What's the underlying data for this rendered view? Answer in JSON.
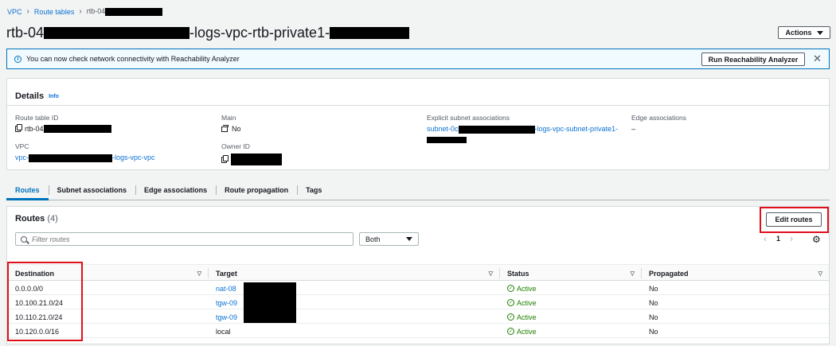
{
  "breadcrumb": {
    "root": "VPC",
    "section": "Route tables",
    "current_prefix": "rtb-04"
  },
  "header": {
    "title_prefix": "rtb-04",
    "title_middle": "-logs-vpc-rtb-private1-",
    "actions_label": "Actions"
  },
  "banner": {
    "message": "You can now check network connectivity with Reachability Analyzer",
    "button_label": "Run Reachability Analyzer"
  },
  "details": {
    "heading": "Details",
    "info_label": "Info",
    "route_table_id": {
      "label": "Route table ID",
      "value_prefix": "rtb-04"
    },
    "main": {
      "label": "Main",
      "value": "No"
    },
    "explicit_subnet": {
      "label": "Explicit subnet associations",
      "value_prefix": "subnet-0c",
      "value_suffix": "-logs-vpc-subnet-private1-"
    },
    "edge": {
      "label": "Edge associations",
      "value": "–"
    },
    "vpc": {
      "label": "VPC",
      "value_prefix": "vpc-",
      "value_suffix": "-logs-vpc-vpc"
    },
    "owner_id": {
      "label": "Owner ID"
    }
  },
  "tabs": [
    "Routes",
    "Subnet associations",
    "Edge associations",
    "Route propagation",
    "Tags"
  ],
  "routes": {
    "title": "Routes",
    "count": "(4)",
    "edit_label": "Edit routes",
    "filter_placeholder": "Filter routes",
    "select_value": "Both",
    "page": "1",
    "columns": [
      "Destination",
      "Target",
      "Status",
      "Propagated"
    ],
    "rows": [
      {
        "destination": "0.0.0.0/0",
        "target": "nat-08",
        "status": "Active",
        "propagated": "No"
      },
      {
        "destination": "10.100.21.0/24",
        "target": "tgw-09",
        "status": "Active",
        "propagated": "No"
      },
      {
        "destination": "10.110.21.0/24",
        "target": "tgw-09",
        "status": "Active",
        "propagated": "No"
      },
      {
        "destination": "10.120.0.0/16",
        "target": "local",
        "status": "Active",
        "propagated": "No"
      }
    ]
  },
  "colors": {
    "link": "#0972d3",
    "active": "#1d8102",
    "highlight": "#e0101b",
    "banner_border": "#0073bb"
  }
}
